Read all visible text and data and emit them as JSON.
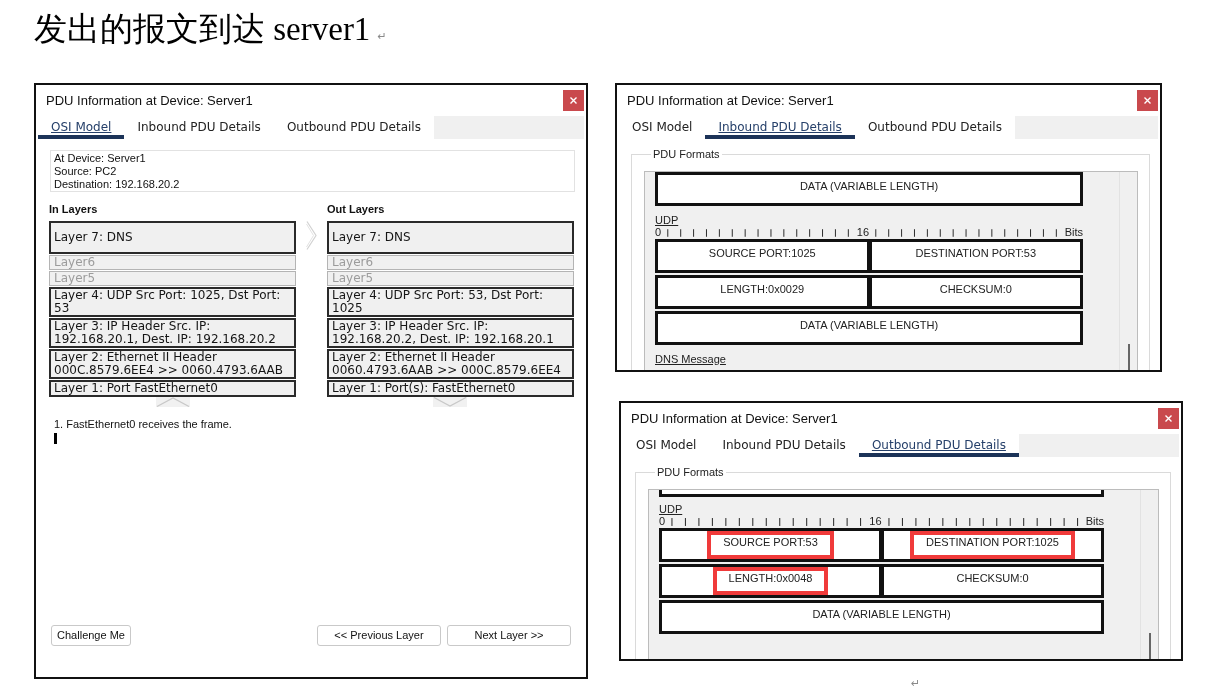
{
  "heading": {
    "text": "发出的报文到达 server1",
    "paragraph_mark": "↵"
  },
  "windows": [
    {
      "kind": "osi_model",
      "title": "PDU Information at Device: Server1",
      "tabs": [
        {
          "label": "OSI Model",
          "selected": true
        },
        {
          "label": "Inbound PDU Details",
          "selected": false
        },
        {
          "label": "Outbound PDU Details",
          "selected": false
        }
      ],
      "device_info": [
        "At Device: Server1",
        "Source: PC2",
        "Destination: 192.168.20.2"
      ],
      "in_layers": {
        "title": "In Layers",
        "layers": [
          {
            "label": "Layer 7: DNS",
            "disabled": false
          },
          {
            "label": "Layer6",
            "disabled": true
          },
          {
            "label": "Layer5",
            "disabled": true
          },
          {
            "label": "Layer 4: UDP Src Port: 1025, Dst Port: 53",
            "disabled": false
          },
          {
            "label": "Layer 3: IP Header Src. IP: 192.168.20.1, Dest. IP: 192.168.20.2",
            "disabled": false
          },
          {
            "label": "Layer 2: Ethernet II Header 000C.8579.6EE4 >> 0060.4793.6AAB",
            "disabled": false
          },
          {
            "label": "Layer 1: Port FastEthernet0",
            "disabled": false
          }
        ]
      },
      "out_layers": {
        "title": "Out Layers",
        "layers": [
          {
            "label": "Layer 7: DNS",
            "disabled": false
          },
          {
            "label": "Layer6",
            "disabled": true
          },
          {
            "label": "Layer5",
            "disabled": true
          },
          {
            "label": "Layer 4: UDP Src Port: 53, Dst Port: 1025",
            "disabled": false
          },
          {
            "label": "Layer 3: IP Header Src. IP: 192.168.20.2, Dest. IP: 192.168.20.1",
            "disabled": false
          },
          {
            "label": "Layer 2: Ethernet II Header 0060.4793.6AAB >> 000C.8579.6EE4",
            "disabled": false
          },
          {
            "label": "Layer 1: Port(s): FastEthernet0",
            "disabled": false
          }
        ]
      },
      "steps": [
        "1. FastEthernet0 receives the frame."
      ],
      "buttons": [
        {
          "label": "Challenge Me"
        },
        {
          "label": "<< Previous Layer"
        },
        {
          "label": "Next Layer >>"
        }
      ]
    },
    {
      "kind": "pdu_formats",
      "title": "PDU Information at Device: Server1",
      "tabs": [
        {
          "label": "OSI Model",
          "selected": false
        },
        {
          "label": "Inbound PDU Details",
          "selected": true
        },
        {
          "label": "Outbound PDU Details",
          "selected": false
        }
      ],
      "group_title": "PDU Formats",
      "pane": [
        {
          "kind": "fields",
          "fields": [
            {
              "label": "DATA (VARIABLE LENGTH)",
              "highlighted": false
            }
          ]
        },
        {
          "kind": "header",
          "label": "UDP"
        },
        {
          "kind": "ruler",
          "start": "0",
          "middle": "16",
          "unit": "Bits"
        },
        {
          "kind": "fields",
          "fields": [
            {
              "label": "SOURCE PORT:1025",
              "highlighted": false
            },
            {
              "label": "DESTINATION PORT:53",
              "highlighted": false
            }
          ]
        },
        {
          "kind": "fields",
          "fields": [
            {
              "label": "LENGTH:0x0029",
              "highlighted": false
            },
            {
              "label": "CHECKSUM:0",
              "highlighted": false
            }
          ]
        },
        {
          "kind": "fields",
          "fields": [
            {
              "label": "DATA (VARIABLE LENGTH)",
              "highlighted": false
            }
          ]
        },
        {
          "kind": "header",
          "label": "DNS Message"
        }
      ]
    },
    {
      "kind": "pdu_formats",
      "title": "PDU Information at Device: Server1",
      "tabs": [
        {
          "label": "OSI Model",
          "selected": false
        },
        {
          "label": "Inbound PDU Details",
          "selected": false
        },
        {
          "label": "Outbound PDU Details",
          "selected": true
        }
      ],
      "group_title": "PDU Formats",
      "pane": [
        {
          "kind": "cut_box"
        },
        {
          "kind": "header",
          "label": "UDP"
        },
        {
          "kind": "ruler",
          "start": "0",
          "middle": "16",
          "unit": "Bits"
        },
        {
          "kind": "fields",
          "fields": [
            {
              "label": "SOURCE PORT:53",
              "highlighted": true
            },
            {
              "label": "DESTINATION PORT:1025",
              "highlighted": true
            }
          ]
        },
        {
          "kind": "fields",
          "fields": [
            {
              "label": "LENGTH:0x0048",
              "highlighted": true
            },
            {
              "label": "CHECKSUM:0",
              "highlighted": false
            }
          ]
        },
        {
          "kind": "fields",
          "fields": [
            {
              "label": "DATA (VARIABLE LENGTH)",
              "highlighted": false
            }
          ]
        }
      ]
    }
  ],
  "end_mark": "↵"
}
